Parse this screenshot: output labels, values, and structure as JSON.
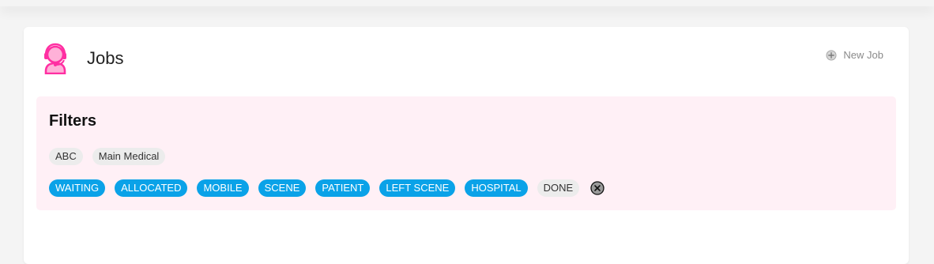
{
  "header": {
    "title": "Jobs",
    "new_job_label": "New Job"
  },
  "filters": {
    "title": "Filters",
    "groups": [
      "ABC",
      "Main Medical"
    ],
    "statuses": [
      {
        "label": "WAITING",
        "active": true
      },
      {
        "label": "ALLOCATED",
        "active": true
      },
      {
        "label": "MOBILE",
        "active": true
      },
      {
        "label": "SCENE",
        "active": true
      },
      {
        "label": "PATIENT",
        "active": true
      },
      {
        "label": "LEFT SCENE",
        "active": true
      },
      {
        "label": "HOSPITAL",
        "active": true
      },
      {
        "label": "DONE",
        "active": false
      }
    ]
  },
  "icons": {
    "logo": "operator-headset-icon",
    "new_job": "plus-circle-icon",
    "clear": "close-circle-icon"
  },
  "colors": {
    "brand_pink": "#ff2fa2",
    "active_chip": "#0aa2e8",
    "inactive_chip": "#ececec",
    "filters_background": "#fff0f6"
  }
}
